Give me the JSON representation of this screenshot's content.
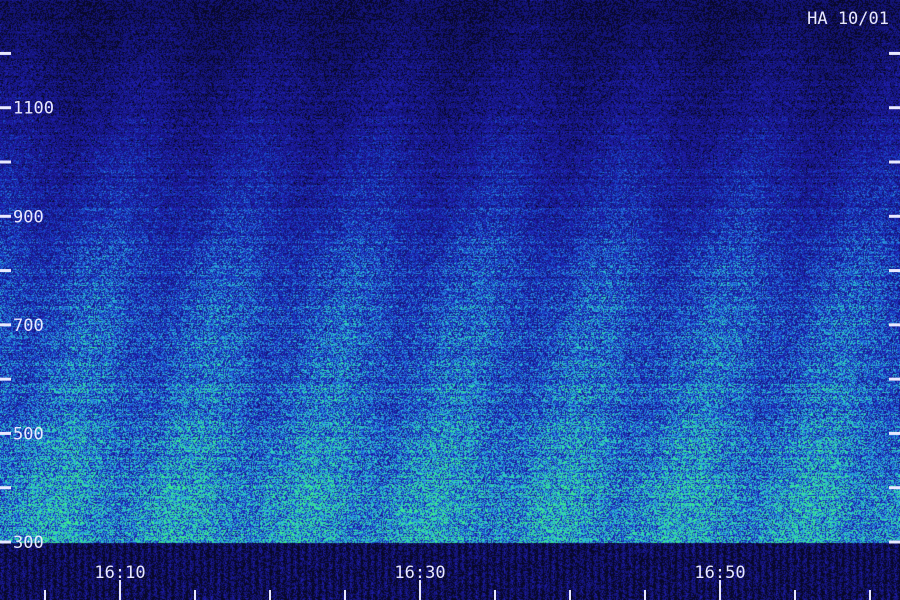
{
  "station_label": "HA 10/01",
  "chart_data": {
    "type": "heatmap",
    "title": "",
    "xlabel": "",
    "ylabel": "",
    "x_range": [
      "16:02",
      "17:02"
    ],
    "y_range": [
      300,
      1280
    ],
    "y_ticks_labeled": [
      300,
      500,
      700,
      900,
      1100
    ],
    "y_ticks_major": [
      300,
      400,
      500,
      600,
      700,
      800,
      900,
      1000,
      1100,
      1200
    ],
    "x_ticks_labeled": [
      "16:10",
      "16:30",
      "16:50"
    ],
    "x_ticks_minor": [
      "16:05",
      "16:10",
      "16:15",
      "16:20",
      "16:25",
      "16:30",
      "16:35",
      "16:40",
      "16:45",
      "16:50",
      "16:55",
      "17:00"
    ],
    "intensity_profile": {
      "frequencies": [
        300,
        400,
        500,
        600,
        700,
        800,
        900,
        1000,
        1100,
        1200,
        1280
      ],
      "relative_intensity": [
        0.85,
        0.8,
        0.72,
        0.66,
        0.6,
        0.54,
        0.45,
        0.36,
        0.28,
        0.22,
        0.18
      ]
    },
    "colors": {
      "background": "#0a0a3a",
      "low": "#1a1aa0",
      "mid": "#2f8fd8",
      "high": "#35e0a0",
      "text": "#e8e8ff"
    }
  }
}
